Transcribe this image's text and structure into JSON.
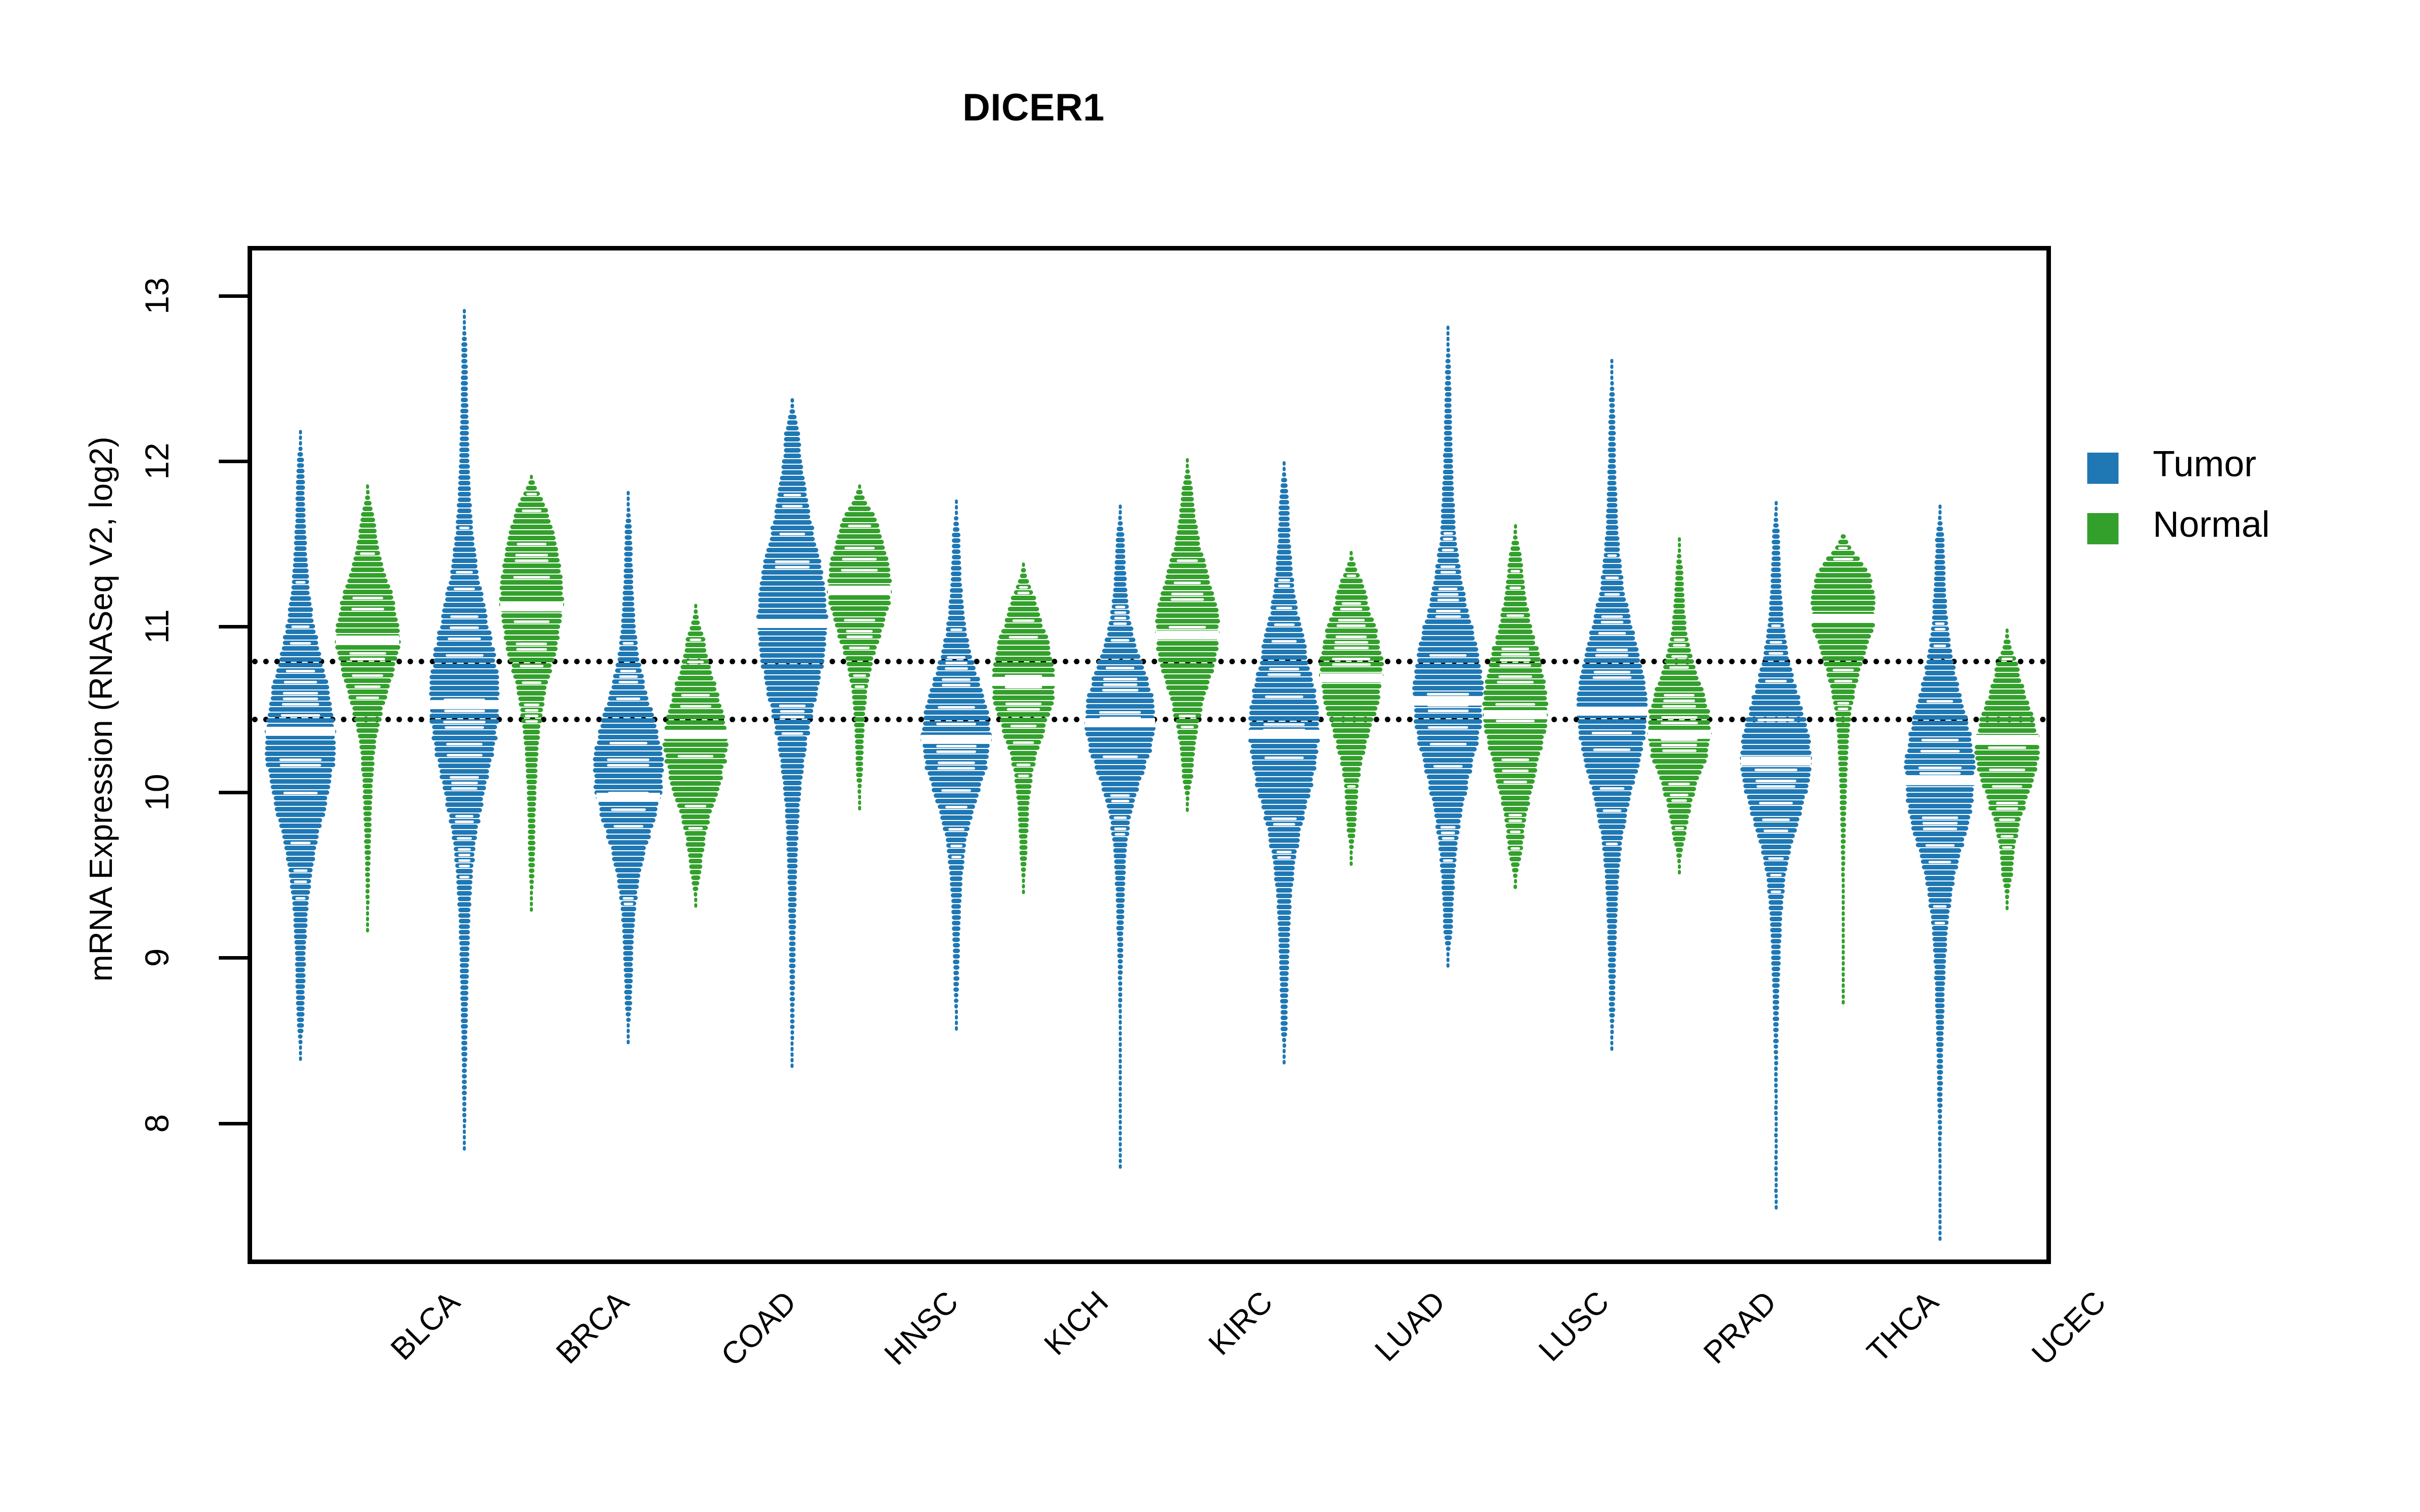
{
  "chart_data": {
    "type": "scatter",
    "plot_style": "beeswarm-violin",
    "title": "DICER1",
    "xlabel": "",
    "ylabel": "mRNA Expression (RNASeq V2, log2)",
    "ylim": [
      7.15,
      13.3
    ],
    "yticks": [
      8,
      9,
      10,
      11,
      12,
      13
    ],
    "ytick_labels": [
      "8",
      "9",
      "10",
      "11",
      "12",
      "13"
    ],
    "grid": false,
    "legend_position": "right",
    "legend": [
      {
        "name": "Tumor",
        "color": "#1f78b4"
      },
      {
        "name": "Normal",
        "color": "#33a02c"
      }
    ],
    "reference_lines": [
      {
        "value": 10.82,
        "style": "dotted",
        "color": "#000000"
      },
      {
        "value": 10.47,
        "style": "dotted",
        "color": "#000000"
      }
    ],
    "categories": [
      "BLCA",
      "BRCA",
      "COAD",
      "HNSC",
      "KICH",
      "KIRC",
      "LUAD",
      "LUSC",
      "PRAD",
      "THCA",
      "UCEC"
    ],
    "series": [
      {
        "name": "Tumor",
        "color": "#1f78b4",
        "groups": [
          {
            "category": "BLCA",
            "median": 10.4,
            "q1": 10.02,
            "q3": 10.72,
            "min": 8.42,
            "max": 12.25,
            "density_peak": 10.35
          },
          {
            "category": "BRCA",
            "median": 10.56,
            "q1": 10.18,
            "q3": 10.94,
            "min": 7.85,
            "max": 12.98,
            "density_peak": 10.6
          },
          {
            "category": "COAD",
            "median": 10.0,
            "q1": 9.78,
            "q3": 10.35,
            "min": 8.52,
            "max": 11.88,
            "density_peak": 10.18
          },
          {
            "category": "HNSC",
            "median": 11.05,
            "q1": 10.62,
            "q3": 11.38,
            "min": 8.35,
            "max": 12.44,
            "density_peak": 11.08
          },
          {
            "category": "KICH",
            "median": 10.35,
            "q1": 10.1,
            "q3": 10.62,
            "min": 8.58,
            "max": 11.83,
            "density_peak": 10.38
          },
          {
            "category": "KIRC",
            "median": 10.45,
            "q1": 10.2,
            "q3": 10.7,
            "min": 7.62,
            "max": 11.8,
            "density_peak": 10.48
          },
          {
            "category": "LUAD",
            "median": 10.38,
            "q1": 10.02,
            "q3": 10.72,
            "min": 8.38,
            "max": 12.06,
            "density_peak": 10.42
          },
          {
            "category": "LUSC",
            "median": 10.58,
            "q1": 10.22,
            "q3": 10.92,
            "min": 8.98,
            "max": 12.88,
            "density_peak": 10.62
          },
          {
            "category": "PRAD",
            "median": 10.52,
            "q1": 10.2,
            "q3": 10.86,
            "min": 8.48,
            "max": 12.68,
            "density_peak": 10.55
          },
          {
            "category": "THCA",
            "median": 10.22,
            "q1": 9.95,
            "q3": 10.52,
            "min": 7.45,
            "max": 11.82,
            "density_peak": 10.25
          },
          {
            "category": "UCEC",
            "median": 10.1,
            "q1": 9.82,
            "q3": 10.48,
            "min": 7.28,
            "max": 11.8,
            "density_peak": 10.15
          }
        ]
      },
      {
        "name": "Normal",
        "color": "#33a02c",
        "groups": [
          {
            "category": "BLCA",
            "median": 10.95,
            "q1": 10.62,
            "q3": 11.12,
            "min": 9.18,
            "max": 11.92,
            "density_peak": 10.98
          },
          {
            "category": "BRCA",
            "median": 11.15,
            "q1": 10.82,
            "q3": 11.45,
            "min": 9.32,
            "max": 11.98,
            "density_peak": 11.22
          },
          {
            "category": "COAD",
            "median": 10.38,
            "q1": 10.12,
            "q3": 10.62,
            "min": 9.35,
            "max": 11.2,
            "density_peak": 10.35
          },
          {
            "category": "HNSC",
            "median": 11.25,
            "q1": 11.0,
            "q3": 11.48,
            "min": 9.92,
            "max": 11.92,
            "density_peak": 11.3
          },
          {
            "category": "KICH",
            "median": 10.7,
            "q1": 10.45,
            "q3": 10.92,
            "min": 9.42,
            "max": 11.45,
            "density_peak": 10.72
          },
          {
            "category": "KIRC",
            "median": 10.98,
            "q1": 10.7,
            "q3": 11.22,
            "min": 9.92,
            "max": 12.08,
            "density_peak": 11.02
          },
          {
            "category": "LUAD",
            "median": 10.72,
            "q1": 10.45,
            "q3": 10.95,
            "min": 9.6,
            "max": 11.52,
            "density_peak": 10.78
          },
          {
            "category": "LUSC",
            "median": 10.5,
            "q1": 10.22,
            "q3": 10.82,
            "min": 9.45,
            "max": 11.68,
            "density_peak": 10.55
          },
          {
            "category": "PRAD",
            "median": 10.38,
            "q1": 10.18,
            "q3": 10.62,
            "min": 9.55,
            "max": 11.6,
            "density_peak": 10.42
          },
          {
            "category": "THCA",
            "median": 11.08,
            "q1": 10.82,
            "q3": 11.3,
            "min": 8.68,
            "max": 11.62,
            "density_peak": 11.15
          },
          {
            "category": "UCEC",
            "median": 10.35,
            "q1": 10.1,
            "q3": 10.55,
            "min": 9.32,
            "max": 11.05,
            "density_peak": 10.3
          }
        ]
      }
    ]
  }
}
